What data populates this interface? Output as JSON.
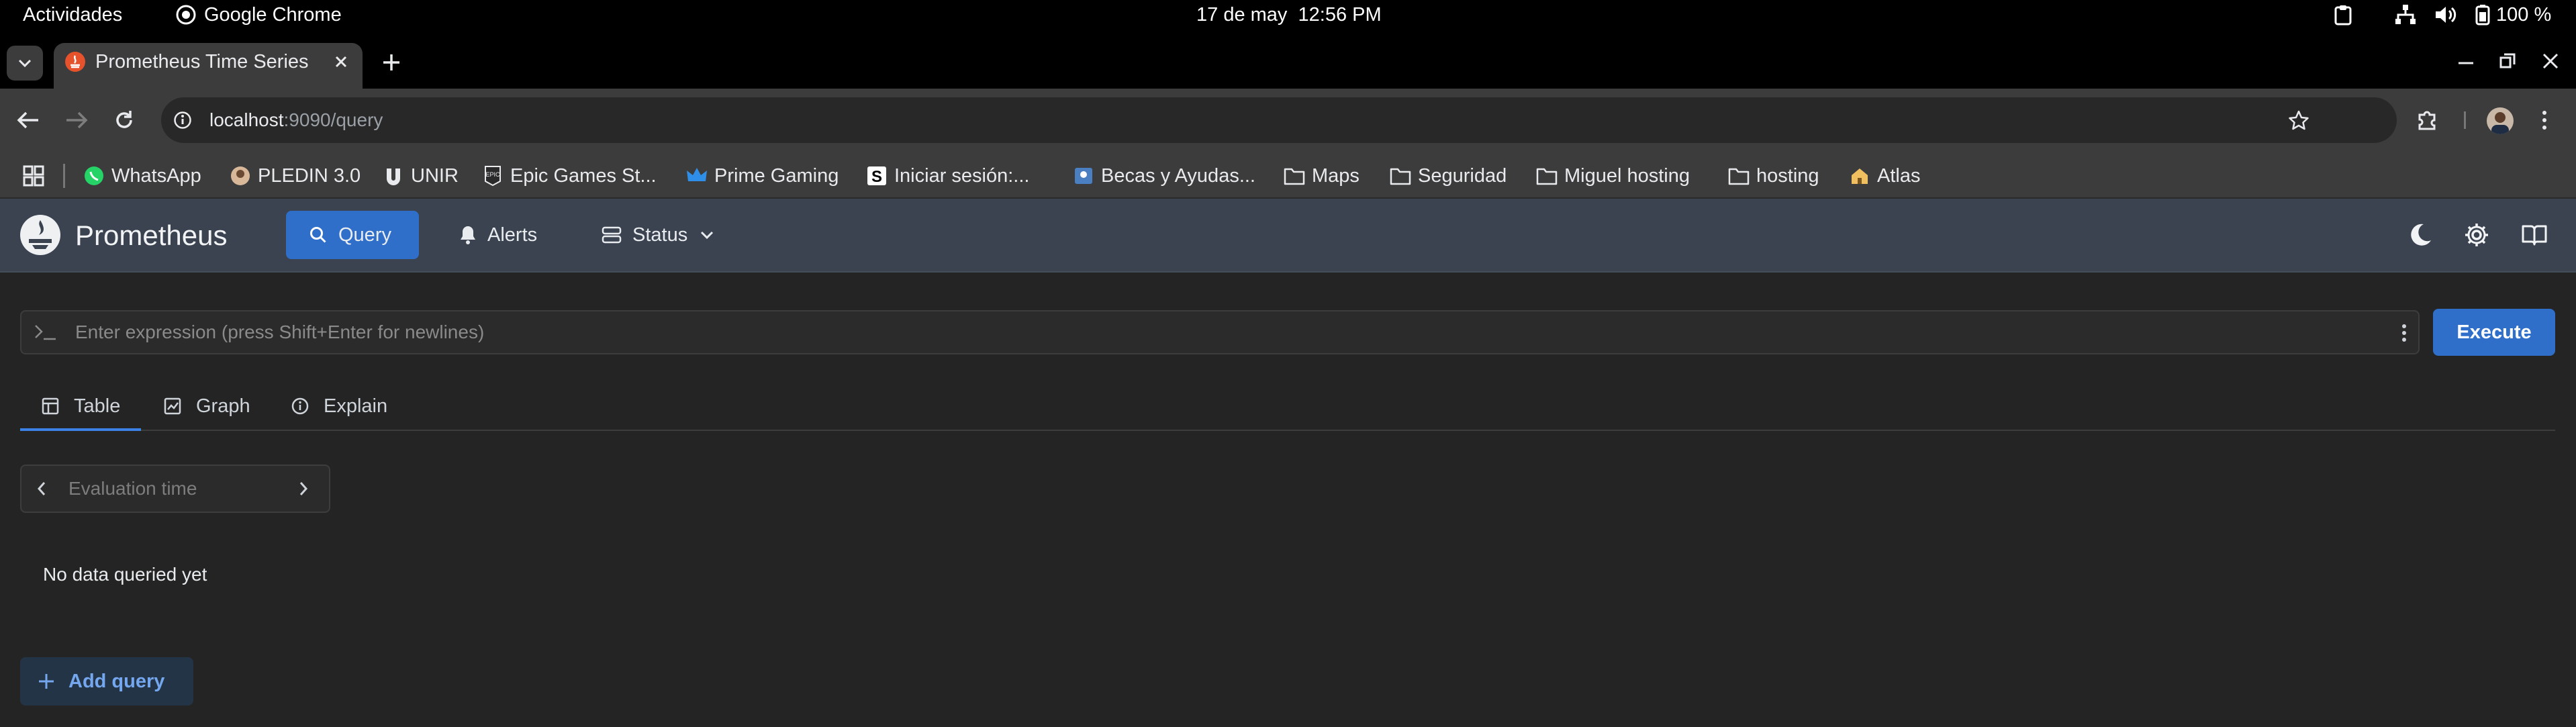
{
  "os_bar": {
    "activities": "Actividades",
    "app_name": "Google Chrome",
    "date": "17 de may",
    "time": "12:56 PM",
    "battery": "100 %"
  },
  "browser": {
    "tab_title": "Prometheus Time Series",
    "url_host": "localhost",
    "url_rest": ":9090/query",
    "bookmarks": [
      {
        "label": "WhatsApp"
      },
      {
        "label": "PLEDIN 3.0"
      },
      {
        "label": "UNIR"
      },
      {
        "label": "Epic Games St..."
      },
      {
        "label": "Prime Gaming"
      },
      {
        "label": "Iniciar sesión:..."
      },
      {
        "label": "Becas y Ayudas..."
      },
      {
        "label": "Maps"
      },
      {
        "label": "Seguridad"
      },
      {
        "label": "Miguel hosting"
      },
      {
        "label": "hosting"
      },
      {
        "label": "Atlas"
      }
    ]
  },
  "app": {
    "brand": "Prometheus",
    "nav": {
      "query": "Query",
      "alerts": "Alerts",
      "status": "Status"
    },
    "expression_placeholder": "Enter expression (press Shift+Enter for newlines)",
    "execute_label": "Execute",
    "tabs": {
      "table": "Table",
      "graph": "Graph",
      "explain": "Explain"
    },
    "eval_time_placeholder": "Evaluation time",
    "no_data": "No data queried yet",
    "add_query": "Add query"
  },
  "colors": {
    "accent": "#2f6fc9",
    "header_bg": "#3b4350",
    "page_bg": "#242424"
  }
}
